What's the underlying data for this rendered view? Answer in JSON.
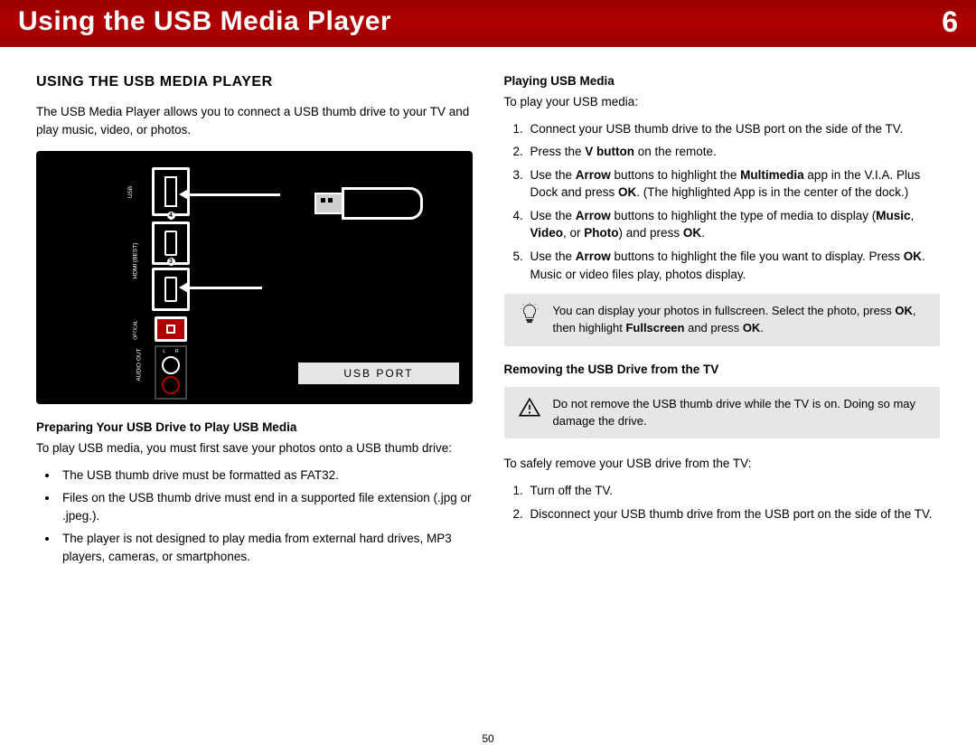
{
  "header": {
    "title": "Using the USB Media Player",
    "chapter": "6"
  },
  "left": {
    "section_title": "USING THE USB MEDIA PLAYER",
    "intro": "The USB Media Player allows you to connect a USB thumb drive to your TV and play music, video, or photos.",
    "fig_label": "USB PORT",
    "sub1": "Preparing Your USB Drive to Play USB Media",
    "sub1_intro": "To play USB media, you must first save your photos onto a USB thumb drive:",
    "sub1_bullets": [
      "The USB thumb drive must be formatted as FAT32.",
      "Files on the USB thumb drive must end in a supported file extension (.jpg or .jpeg.).",
      "The player is not designed to play media from external hard drives, MP3 players, cameras, or smartphones."
    ]
  },
  "right": {
    "sub2": "Playing USB Media",
    "sub2_intro": "To play your USB media:",
    "steps": [
      "Connect your USB thumb drive to the USB port on the side of the TV.",
      "Press the <strong>V button</strong> on the remote.",
      "Use the <strong>Arrow</strong> buttons to highlight the <strong>Multimedia</strong> app in the V.I.A. Plus Dock and press <strong>OK</strong>. (The highlighted App is in the center of the dock.)",
      "Use the <strong>Arrow</strong> buttons to highlight the type of media to display (<strong>Music</strong>, <strong>Video</strong>, or <strong>Photo</strong>) and press <strong>OK</strong>.",
      "Use the <strong>Arrow</strong> buttons to highlight the file you want to display. Press <strong>OK</strong>. Music or video files play, photos display."
    ],
    "tip": "You can display your photos in fullscreen. Select the photo, press <strong>OK</strong>, then highlight <strong>Fullscreen</strong> and press <strong>OK</strong>.",
    "sub3": "Removing the USB Drive from the TV",
    "warn": "Do not remove the USB thumb drive while the TV is on. Doing so may damage the drive.",
    "sub3_intro": "To safely remove your USB drive from the TV:",
    "remove_steps": [
      "Turn off the TV.",
      "Disconnect your USB thumb drive from the USB port on the side of the TV."
    ]
  },
  "page": "50"
}
